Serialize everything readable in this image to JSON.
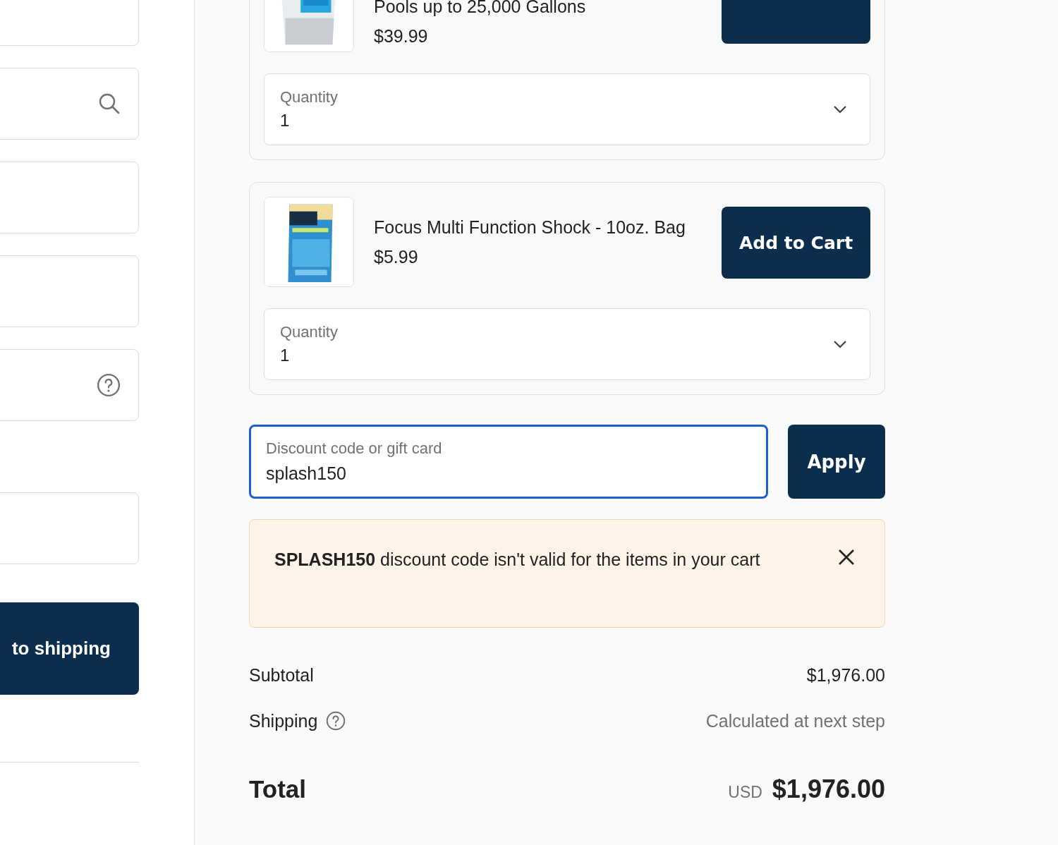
{
  "left_panel": {
    "fields": [
      {
        "kind": "plain"
      },
      {
        "kind": "search"
      },
      {
        "kind": "plain"
      },
      {
        "kind": "plain"
      },
      {
        "kind": "help"
      }
    ],
    "fields_group_2": [
      {
        "kind": "plain"
      }
    ],
    "continue_button": "to shipping"
  },
  "products": [
    {
      "kind": "picture",
      "title": "Pools up to 25,000 Gallons",
      "price": "$39.99",
      "quantity_label": "Quantity",
      "quantity": "1"
    },
    {
      "kind": "picture",
      "title": "Focus Multi Function Shock - 10oz. Bag",
      "price": "$5.99",
      "button": "Add to Cart",
      "quantity_label": "Quantity",
      "quantity": "1"
    }
  ],
  "discount": {
    "label": "Discount code or gift card",
    "value": "splash150",
    "focused": true,
    "apply_button": "Apply"
  },
  "alert": {
    "message": "**SPLASH150** discount code isn't valid for the items in your cart"
  },
  "summary": {
    "subtotal_label": "Subtotal",
    "subtotal": "$1,976.00",
    "shipping_label": "Shipping",
    "shipping": "Calculated at next step",
    "total_label": "Total",
    "currency": "USD",
    "total": "$1,976.00"
  }
}
